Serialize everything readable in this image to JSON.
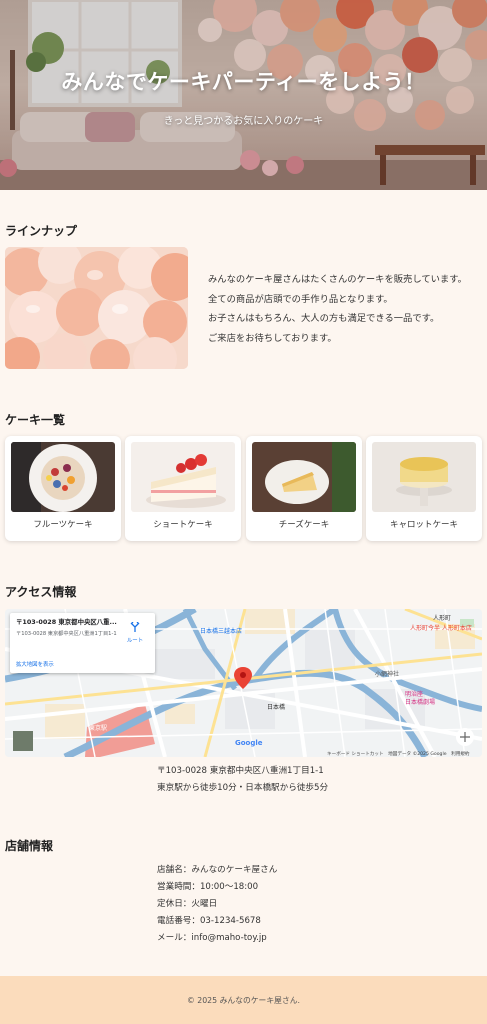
{
  "hero": {
    "title": "みんなでケーキパーティーをしよう！",
    "subtitle": "きっと見つかるお気に入りのケーキ"
  },
  "lineup": {
    "heading": "ラインナップ",
    "image": "balloons-photo",
    "lines": [
      "みんなのケーキ屋さんはたくさんのケーキを販売しています。",
      "全ての商品が店頭での手作り品となります。",
      "お子さんはもちろん、大人の方も満足できる一品です。",
      "ご来店をお待ちしております。"
    ]
  },
  "cakes": {
    "heading": "ケーキ一覧",
    "items": [
      {
        "name": "フルーツケーキ",
        "image": "fruit-cake-photo"
      },
      {
        "name": "ショートケーキ",
        "image": "shortcake-photo"
      },
      {
        "name": "チーズケーキ",
        "image": "cheesecake-photo"
      },
      {
        "name": "キャロットケーキ",
        "image": "carrot-cake-photo"
      }
    ]
  },
  "access": {
    "heading": "アクセス情報",
    "map": {
      "card_title": "〒103-0028 東京都中央区八重...",
      "card_address": "〒103-0028 東京都中央区八重洲1丁目1-1",
      "directions_label": "ルート",
      "larger_map_label": "拡大地図を表示",
      "place_labels": [
        "日本橋三越本店",
        "日本橋",
        "人形町",
        "人形町今半 人形町本店",
        "小網神社",
        "東京駅",
        "明治座",
        "日本橋劇場"
      ],
      "attribution": "キーボード ショートカット　地図データ ©2025 Google　利用規約",
      "google_label": "Google"
    },
    "address": "〒103-0028 東京都中央区八重洲1丁目1-1",
    "directions": "東京駅から徒歩10分・日本橋駅から徒歩5分"
  },
  "shop": {
    "heading": "店舗情報",
    "name": "店舗名：みんなのケーキ屋さん",
    "hours": "営業時間：10:00〜18:00",
    "closed": "定休日：火曜日",
    "phone": "電話番号：03-1234-5678",
    "email": "メール：info@maho-toy.jp"
  },
  "footer": {
    "copyright": "© 2025 みんなのケーキ屋さん."
  },
  "colors": {
    "page_bg": "#fdf6f0",
    "footer_bg": "#fbdcbc",
    "link_blue": "#1a73e8",
    "map_pin": "#ea4335"
  }
}
